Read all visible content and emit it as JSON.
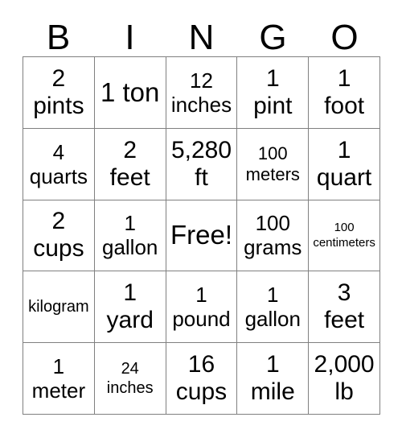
{
  "card": {
    "header_letters": [
      "B",
      "I",
      "N",
      "G",
      "O"
    ],
    "rows": [
      [
        {
          "text": "2\npints",
          "size": "md"
        },
        {
          "text": "1 ton",
          "size": "lg"
        },
        {
          "text": "12\ninches",
          "size": "sm"
        },
        {
          "text": "1\npint",
          "size": "md"
        },
        {
          "text": "1\nfoot",
          "size": "md"
        }
      ],
      [
        {
          "text": "4\nquarts",
          "size": "sm"
        },
        {
          "text": "2\nfeet",
          "size": "md"
        },
        {
          "text": "5,280\nft",
          "size": "md"
        },
        {
          "text": "100\nmeters",
          "size": "xs"
        },
        {
          "text": "1\nquart",
          "size": "md"
        }
      ],
      [
        {
          "text": "2\ncups",
          "size": "md"
        },
        {
          "text": "1\ngallon",
          "size": "sm"
        },
        {
          "text": "Free!",
          "size": "lg"
        },
        {
          "text": "100\ngrams",
          "size": "sm"
        },
        {
          "text": "100\ncentimeters",
          "size": "tiny"
        }
      ],
      [
        {
          "text": "kilogram",
          "size": "xxs"
        },
        {
          "text": "1\nyard",
          "size": "md"
        },
        {
          "text": "1\npound",
          "size": "sm"
        },
        {
          "text": "1\ngallon",
          "size": "sm"
        },
        {
          "text": "3\nfeet",
          "size": "md"
        }
      ],
      [
        {
          "text": "1\nmeter",
          "size": "sm"
        },
        {
          "text": "24\ninches",
          "size": "xxs"
        },
        {
          "text": "16\ncups",
          "size": "md"
        },
        {
          "text": "1\nmile",
          "size": "md"
        },
        {
          "text": "2,000\nlb",
          "size": "md"
        }
      ]
    ]
  },
  "colors": {
    "border": "#808080",
    "text": "#000000",
    "background": "#ffffff"
  }
}
